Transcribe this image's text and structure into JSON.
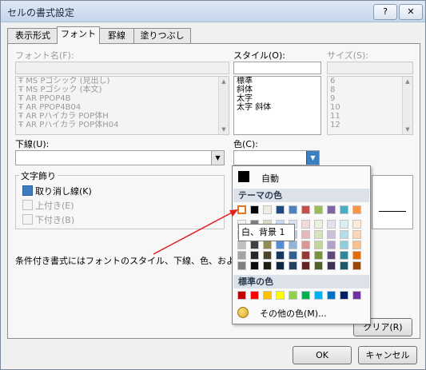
{
  "window": {
    "title": "セルの書式設定",
    "help_label": "?",
    "close_label": "✕"
  },
  "tabs": [
    "表示形式",
    "フォント",
    "罫線",
    "塗りつぶし"
  ],
  "font_name": {
    "label": "フォント名(F):",
    "items": [
      "MS Pゴシック (見出し)",
      "MS Pゴシック (本文)",
      "AR PPOP4B",
      "AR PPOP4B04",
      "AR Pハイカラ POP体H",
      "AR Pハイカラ POP体H04"
    ]
  },
  "style": {
    "label": "スタイル(O):",
    "items": [
      "標準",
      "斜体",
      "太字",
      "太字 斜体"
    ]
  },
  "size": {
    "label": "サイズ(S):",
    "items": [
      "6",
      "8",
      "9",
      "10",
      "11",
      "12"
    ]
  },
  "underline": {
    "label": "下線(U):"
  },
  "color": {
    "label": "色(C):"
  },
  "effects": {
    "label": "文字飾り",
    "strikethrough": "取り消し線(K)",
    "superscript": "上付き(E)",
    "subscript": "下付き(B)"
  },
  "note": "条件付き書式にはフォントのスタイル、下線、色、および取り",
  "buttons": {
    "clear": "クリア(R)",
    "ok": "OK",
    "cancel": "キャンセル"
  },
  "color_popup": {
    "auto_label": "自動",
    "theme_label": "テーマの色",
    "standard_label": "標準の色",
    "more_label": "その他の色(M)...",
    "tooltip": "白、背景 1",
    "theme_colors": [
      "#ffffff",
      "#000000",
      "#eeece1",
      "#1f497d",
      "#4f81bd",
      "#c0504d",
      "#9bbb59",
      "#8064a2",
      "#4bacc6",
      "#f79646"
    ],
    "theme_shades": [
      [
        "#f2f2f2",
        "#7f7f7f",
        "#ddd9c3",
        "#c6d9f0",
        "#dbe5f1",
        "#f2dcdb",
        "#ebf1dd",
        "#e5e0ec",
        "#dbeef3",
        "#fdeada"
      ],
      [
        "#d8d8d8",
        "#595959",
        "#c4bd97",
        "#8db3e2",
        "#b8cce4",
        "#e5b9b7",
        "#d7e3bc",
        "#ccc1d9",
        "#b7dde8",
        "#fbd5b5"
      ],
      [
        "#bfbfbf",
        "#3f3f3f",
        "#938953",
        "#548dd4",
        "#95b3d7",
        "#d99694",
        "#c3d69b",
        "#b2a2c7",
        "#92cddc",
        "#fac08f"
      ],
      [
        "#a5a5a5",
        "#262626",
        "#494429",
        "#17365d",
        "#366092",
        "#953734",
        "#76923c",
        "#5f497a",
        "#31859b",
        "#e36c09"
      ],
      [
        "#7f7f7f",
        "#0c0c0c",
        "#1d1b10",
        "#0f243e",
        "#244061",
        "#632423",
        "#4f6128",
        "#3f3151",
        "#205867",
        "#974806"
      ]
    ],
    "standard_colors": [
      "#c00000",
      "#ff0000",
      "#ffc000",
      "#ffff00",
      "#92d050",
      "#00b050",
      "#00b0f0",
      "#0070c0",
      "#002060",
      "#7030a0"
    ]
  }
}
